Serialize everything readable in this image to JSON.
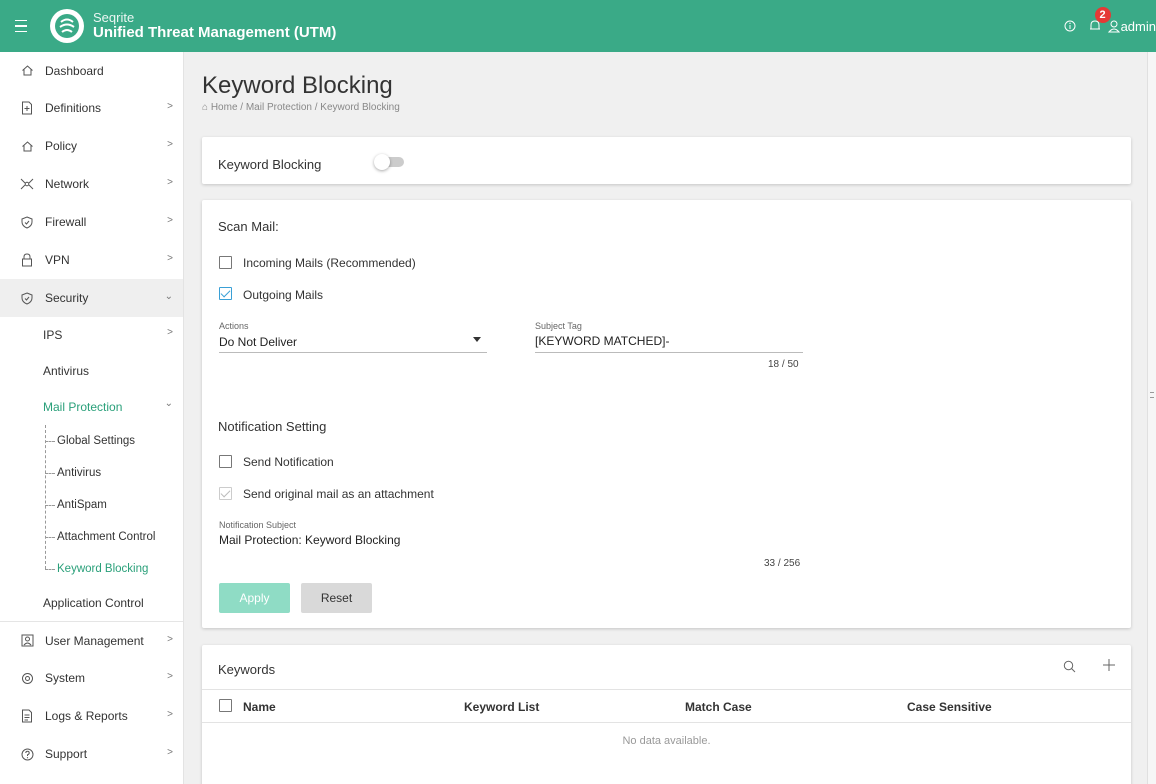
{
  "topbar": {
    "brand_small": "Seqrite",
    "brand_title": "Unified Threat Management (UTM)",
    "notification_count": "2",
    "user": "admin"
  },
  "sidebar": {
    "items": [
      {
        "label": "Dashboard"
      },
      {
        "label": "Definitions"
      },
      {
        "label": "Policy"
      },
      {
        "label": "Network"
      },
      {
        "label": "Firewall"
      },
      {
        "label": "VPN"
      },
      {
        "label": "Security"
      }
    ],
    "security_children": {
      "ips": "IPS",
      "antivirus": "Antivirus",
      "mail_protection": "Mail Protection",
      "application_control": "Application Control"
    },
    "mail_children": [
      "Global Settings",
      "Antivirus",
      "AntiSpam",
      "Attachment Control",
      "Keyword Blocking"
    ],
    "bottom_items": [
      {
        "label": "User Management"
      },
      {
        "label": "System"
      },
      {
        "label": "Logs & Reports"
      },
      {
        "label": "Support"
      }
    ]
  },
  "page": {
    "title": "Keyword Blocking",
    "breadcrumb": "Home / Mail Protection / Keyword Blocking"
  },
  "toggle_card": {
    "label": "Keyword Blocking",
    "enabled": false
  },
  "scan": {
    "title": "Scan Mail:",
    "incoming_label": "Incoming Mails (Recommended)",
    "incoming_checked": false,
    "outgoing_label": "Outgoing Mails",
    "outgoing_checked": true,
    "actions_label": "Actions",
    "actions_value": "Do Not Deliver",
    "subject_tag_label": "Subject Tag",
    "subject_tag_value": "[KEYWORD MATCHED]-",
    "subject_tag_counter": "18 / 50"
  },
  "notification": {
    "title": "Notification Setting",
    "send_label": "Send Notification",
    "send_checked": false,
    "attach_label": "Send original mail as an attachment",
    "subject_label": "Notification Subject",
    "subject_value": "Mail Protection: Keyword Blocking",
    "subject_counter": "33 / 256"
  },
  "buttons": {
    "apply": "Apply",
    "reset": "Reset"
  },
  "keywords": {
    "title": "Keywords",
    "columns": [
      "Name",
      "Keyword List",
      "Match Case",
      "Case Sensitive"
    ],
    "empty": "No data available."
  },
  "colors": {
    "brand": "#3aaa87",
    "active": "#2aa07a",
    "apply_disabled": "#8fdcc5"
  }
}
